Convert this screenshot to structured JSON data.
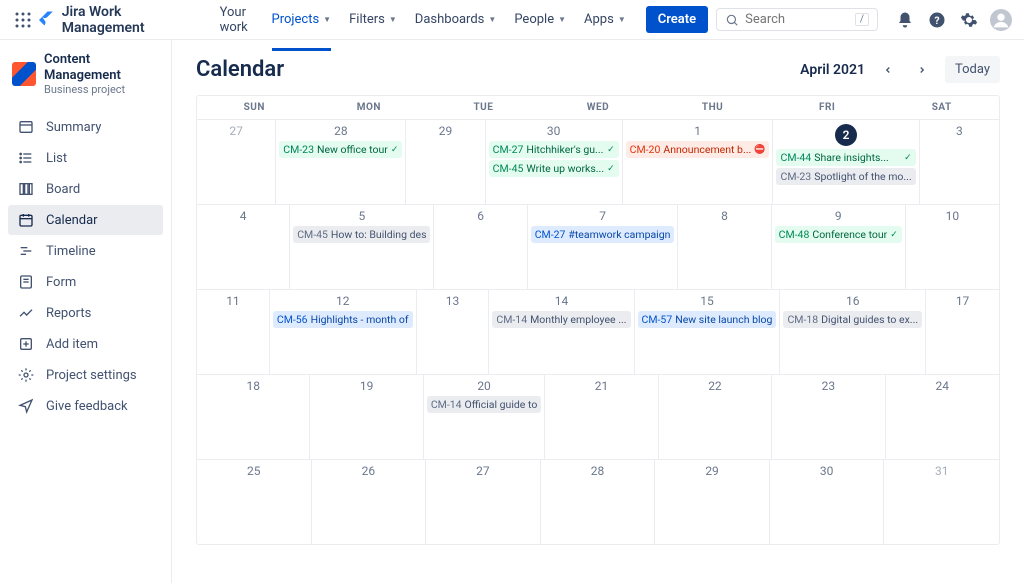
{
  "app": {
    "name": "Jira Work Management"
  },
  "topnav": {
    "items": [
      {
        "label": "Your work",
        "dropdown": false
      },
      {
        "label": "Projects",
        "dropdown": true,
        "active": true
      },
      {
        "label": "Filters",
        "dropdown": true
      },
      {
        "label": "Dashboards",
        "dropdown": true
      },
      {
        "label": "People",
        "dropdown": true
      },
      {
        "label": "Apps",
        "dropdown": true
      }
    ],
    "create": "Create",
    "search_placeholder": "Search"
  },
  "project": {
    "name": "Content Management",
    "type": "Business project"
  },
  "sidebar": {
    "items": [
      {
        "label": "Summary",
        "icon": "summary"
      },
      {
        "label": "List",
        "icon": "list"
      },
      {
        "label": "Board",
        "icon": "board"
      },
      {
        "label": "Calendar",
        "icon": "calendar",
        "active": true
      },
      {
        "label": "Timeline",
        "icon": "timeline"
      },
      {
        "label": "Form",
        "icon": "form"
      },
      {
        "label": "Reports",
        "icon": "reports"
      },
      {
        "label": "Add item",
        "icon": "add"
      },
      {
        "label": "Project settings",
        "icon": "settings"
      },
      {
        "label": "Give feedback",
        "icon": "feedback"
      }
    ]
  },
  "calendar": {
    "title": "Calendar",
    "month": "April 2021",
    "today": "Today",
    "day_headers": [
      "SUN",
      "MON",
      "TUE",
      "WED",
      "THU",
      "FRI",
      "SAT"
    ],
    "weeks": [
      [
        {
          "day": "27",
          "other": true
        },
        {
          "day": "28",
          "events": [
            {
              "key": "CM-23",
              "title": "New office tour",
              "color": "green",
              "status": "check"
            }
          ]
        },
        {
          "day": "29"
        },
        {
          "day": "30",
          "events": [
            {
              "key": "CM-27",
              "title": "Hitchhiker's gu...",
              "color": "green",
              "status": "check"
            },
            {
              "key": "CM-45",
              "title": "Write up works...",
              "color": "green",
              "status": "check"
            }
          ]
        },
        {
          "day": "1",
          "events": [
            {
              "key": "CM-20",
              "title": "Announcement b...",
              "color": "red",
              "status": "blocked"
            }
          ]
        },
        {
          "day": "2",
          "today": true,
          "events": [
            {
              "key": "CM-44",
              "title": "Share insights...",
              "color": "green",
              "status": "check"
            },
            {
              "key": "CM-23",
              "title": "Spotlight of the mo...",
              "color": "gray"
            }
          ]
        },
        {
          "day": "3"
        }
      ],
      [
        {
          "day": "4"
        },
        {
          "day": "5",
          "events": [
            {
              "key": "CM-45",
              "title": "How to: Building des",
              "color": "gray"
            }
          ]
        },
        {
          "day": "6"
        },
        {
          "day": "7",
          "events": [
            {
              "key": "CM-27",
              "title": "#teamwork campaign",
              "color": "blue"
            }
          ]
        },
        {
          "day": "8"
        },
        {
          "day": "9",
          "events": [
            {
              "key": "CM-48",
              "title": "Conference tour",
              "color": "green",
              "status": "check"
            }
          ]
        },
        {
          "day": "10"
        }
      ],
      [
        {
          "day": "11"
        },
        {
          "day": "12",
          "events": [
            {
              "key": "CM-56",
              "title": "Highlights - month of",
              "color": "blue"
            }
          ]
        },
        {
          "day": "13"
        },
        {
          "day": "14",
          "events": [
            {
              "key": "CM-14",
              "title": "Monthly employee ...",
              "color": "gray"
            }
          ]
        },
        {
          "day": "15",
          "events": [
            {
              "key": "CM-57",
              "title": "New site launch blog",
              "color": "blue"
            }
          ]
        },
        {
          "day": "16",
          "events": [
            {
              "key": "CM-18",
              "title": "Digital guides to ex...",
              "color": "gray"
            }
          ]
        },
        {
          "day": "17"
        }
      ],
      [
        {
          "day": "18"
        },
        {
          "day": "19"
        },
        {
          "day": "20",
          "events": [
            {
              "key": "CM-14",
              "title": "Official guide to",
              "color": "gray"
            }
          ]
        },
        {
          "day": "21"
        },
        {
          "day": "22"
        },
        {
          "day": "23"
        },
        {
          "day": "24"
        }
      ],
      [
        {
          "day": "25"
        },
        {
          "day": "26"
        },
        {
          "day": "27"
        },
        {
          "day": "28"
        },
        {
          "day": "29"
        },
        {
          "day": "30"
        },
        {
          "day": "31",
          "other": true
        }
      ]
    ]
  }
}
